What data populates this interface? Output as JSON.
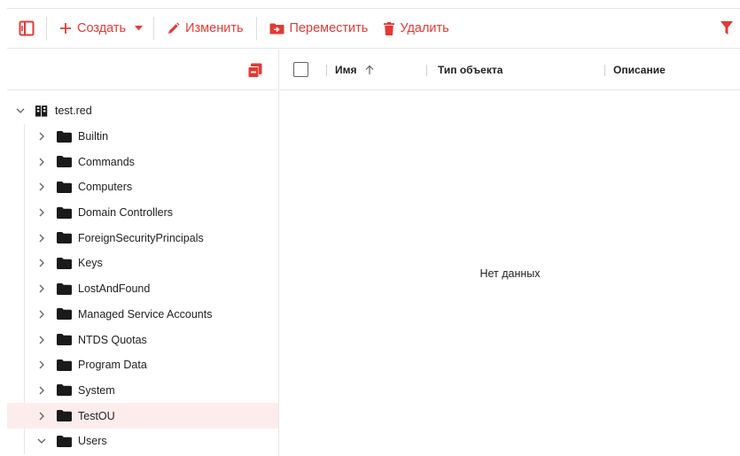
{
  "toolbar": {
    "create_label": "Создать",
    "edit_label": "Изменить",
    "move_label": "Переместить",
    "delete_label": "Удалить"
  },
  "colors": {
    "accent": "#e53935",
    "selected_bg": "#fdecec",
    "folder": "#1a1a1a"
  },
  "icons": [
    "sidebar-toggle-icon",
    "plus-icon",
    "caret-down-icon",
    "pencil-icon",
    "move-folder-icon",
    "trash-icon",
    "filter-icon",
    "collapse-all-icon",
    "domain-icon",
    "folder-icon",
    "chevron-right-icon",
    "chevron-down-icon",
    "sort-arrow-up-icon"
  ],
  "tree": {
    "root": "test.red",
    "children": [
      {
        "label": "Builtin",
        "expanded": false,
        "selected": false
      },
      {
        "label": "Commands",
        "expanded": false,
        "selected": false
      },
      {
        "label": "Computers",
        "expanded": false,
        "selected": false
      },
      {
        "label": "Domain Controllers",
        "expanded": false,
        "selected": false
      },
      {
        "label": "ForeignSecurityPrincipals",
        "expanded": false,
        "selected": false
      },
      {
        "label": "Keys",
        "expanded": false,
        "selected": false
      },
      {
        "label": "LostAndFound",
        "expanded": false,
        "selected": false
      },
      {
        "label": "Managed Service Accounts",
        "expanded": false,
        "selected": false
      },
      {
        "label": "NTDS Quotas",
        "expanded": false,
        "selected": false
      },
      {
        "label": "Program Data",
        "expanded": false,
        "selected": false
      },
      {
        "label": "System",
        "expanded": false,
        "selected": false
      },
      {
        "label": "TestOU",
        "expanded": false,
        "selected": true
      },
      {
        "label": "Users",
        "expanded": true,
        "selected": false
      }
    ]
  },
  "table": {
    "columns": [
      "Имя",
      "Тип объекта",
      "Описание"
    ],
    "sort_column": "Имя",
    "sort_direction": "asc",
    "empty_text": "Нет данных"
  }
}
